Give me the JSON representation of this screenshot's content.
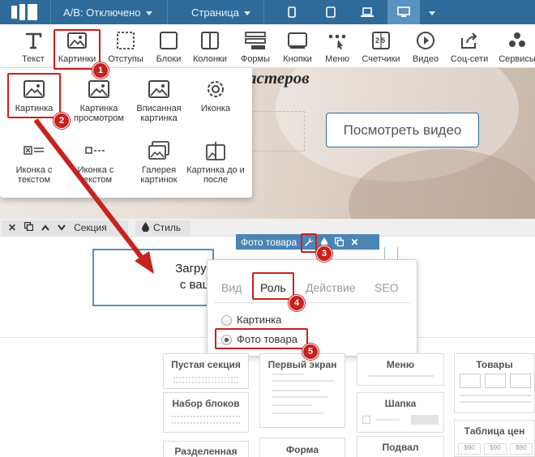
{
  "topbar": {
    "ab_label": "A/B: Отключено",
    "page_label": "Страница"
  },
  "toolbar": {
    "items": [
      {
        "label": "Текст",
        "icon": "text-t-icon"
      },
      {
        "label": "Картинки",
        "icon": "image-icon"
      },
      {
        "label": "Отступы",
        "icon": "spacing-icon"
      },
      {
        "label": "Блоки",
        "icon": "block-icon"
      },
      {
        "label": "Колонки",
        "icon": "columns-icon"
      },
      {
        "label": "Формы",
        "icon": "form-icon"
      },
      {
        "label": "Кнопки",
        "icon": "button-icon"
      },
      {
        "label": "Меню",
        "icon": "menu-icon"
      },
      {
        "label": "Счетчики",
        "icon": "counter-icon"
      },
      {
        "label": "Видео",
        "icon": "video-icon"
      },
      {
        "label": "Соц-сети",
        "icon": "share-icon"
      },
      {
        "label": "Сервисы",
        "icon": "services-icon"
      }
    ]
  },
  "hero": {
    "title": "астеров",
    "watch_button": "Посмотреть видео"
  },
  "dropdown": {
    "items": [
      {
        "label": "Картинка",
        "icon": "image-icon"
      },
      {
        "label": "Картинка просмотром",
        "icon": "image-preview-icon"
      },
      {
        "label": "Вписанная картинка",
        "icon": "image-fit-icon"
      },
      {
        "label": "Иконка",
        "icon": "gear-icon"
      },
      {
        "label": "Иконка с текстом",
        "icon": "icon-text-icon"
      },
      {
        "label": "Иконка с текстом",
        "icon": "icon-text-line-icon"
      },
      {
        "label": "Галерея картинок",
        "icon": "gallery-icon"
      },
      {
        "label": "Картинка до и после",
        "icon": "before-after-icon"
      }
    ]
  },
  "section_bar": {
    "section_label": "Секция",
    "style_label": "Стиль"
  },
  "element_bar": {
    "label": "Фото товара"
  },
  "product_text": {
    "line1": "Загрузи",
    "line2": "с ваше"
  },
  "popup": {
    "tabs": [
      "Вид",
      "Роль",
      "Действие",
      "SEO"
    ],
    "active_tab": "Роль",
    "options": [
      "Картинка",
      "Фото товара"
    ],
    "selected": "Фото товара"
  },
  "templates": [
    {
      "title": "Пустая секция"
    },
    {
      "title": "Первый экран"
    },
    {
      "title": "Меню"
    },
    {
      "title": "Товары"
    },
    {
      "title": "Набор блоков"
    },
    {
      "title": "Шапка"
    },
    {
      "title": "Таблица цен"
    },
    {
      "title": "Разделенная"
    },
    {
      "title": "Форма"
    },
    {
      "title": "Подвал"
    }
  ],
  "annotations": [
    "1",
    "2",
    "3",
    "4",
    "5"
  ],
  "colors": {
    "nav_bg": "#2e6b9b",
    "accent_red": "#c9211e",
    "element_bar": "#4c84b5"
  }
}
